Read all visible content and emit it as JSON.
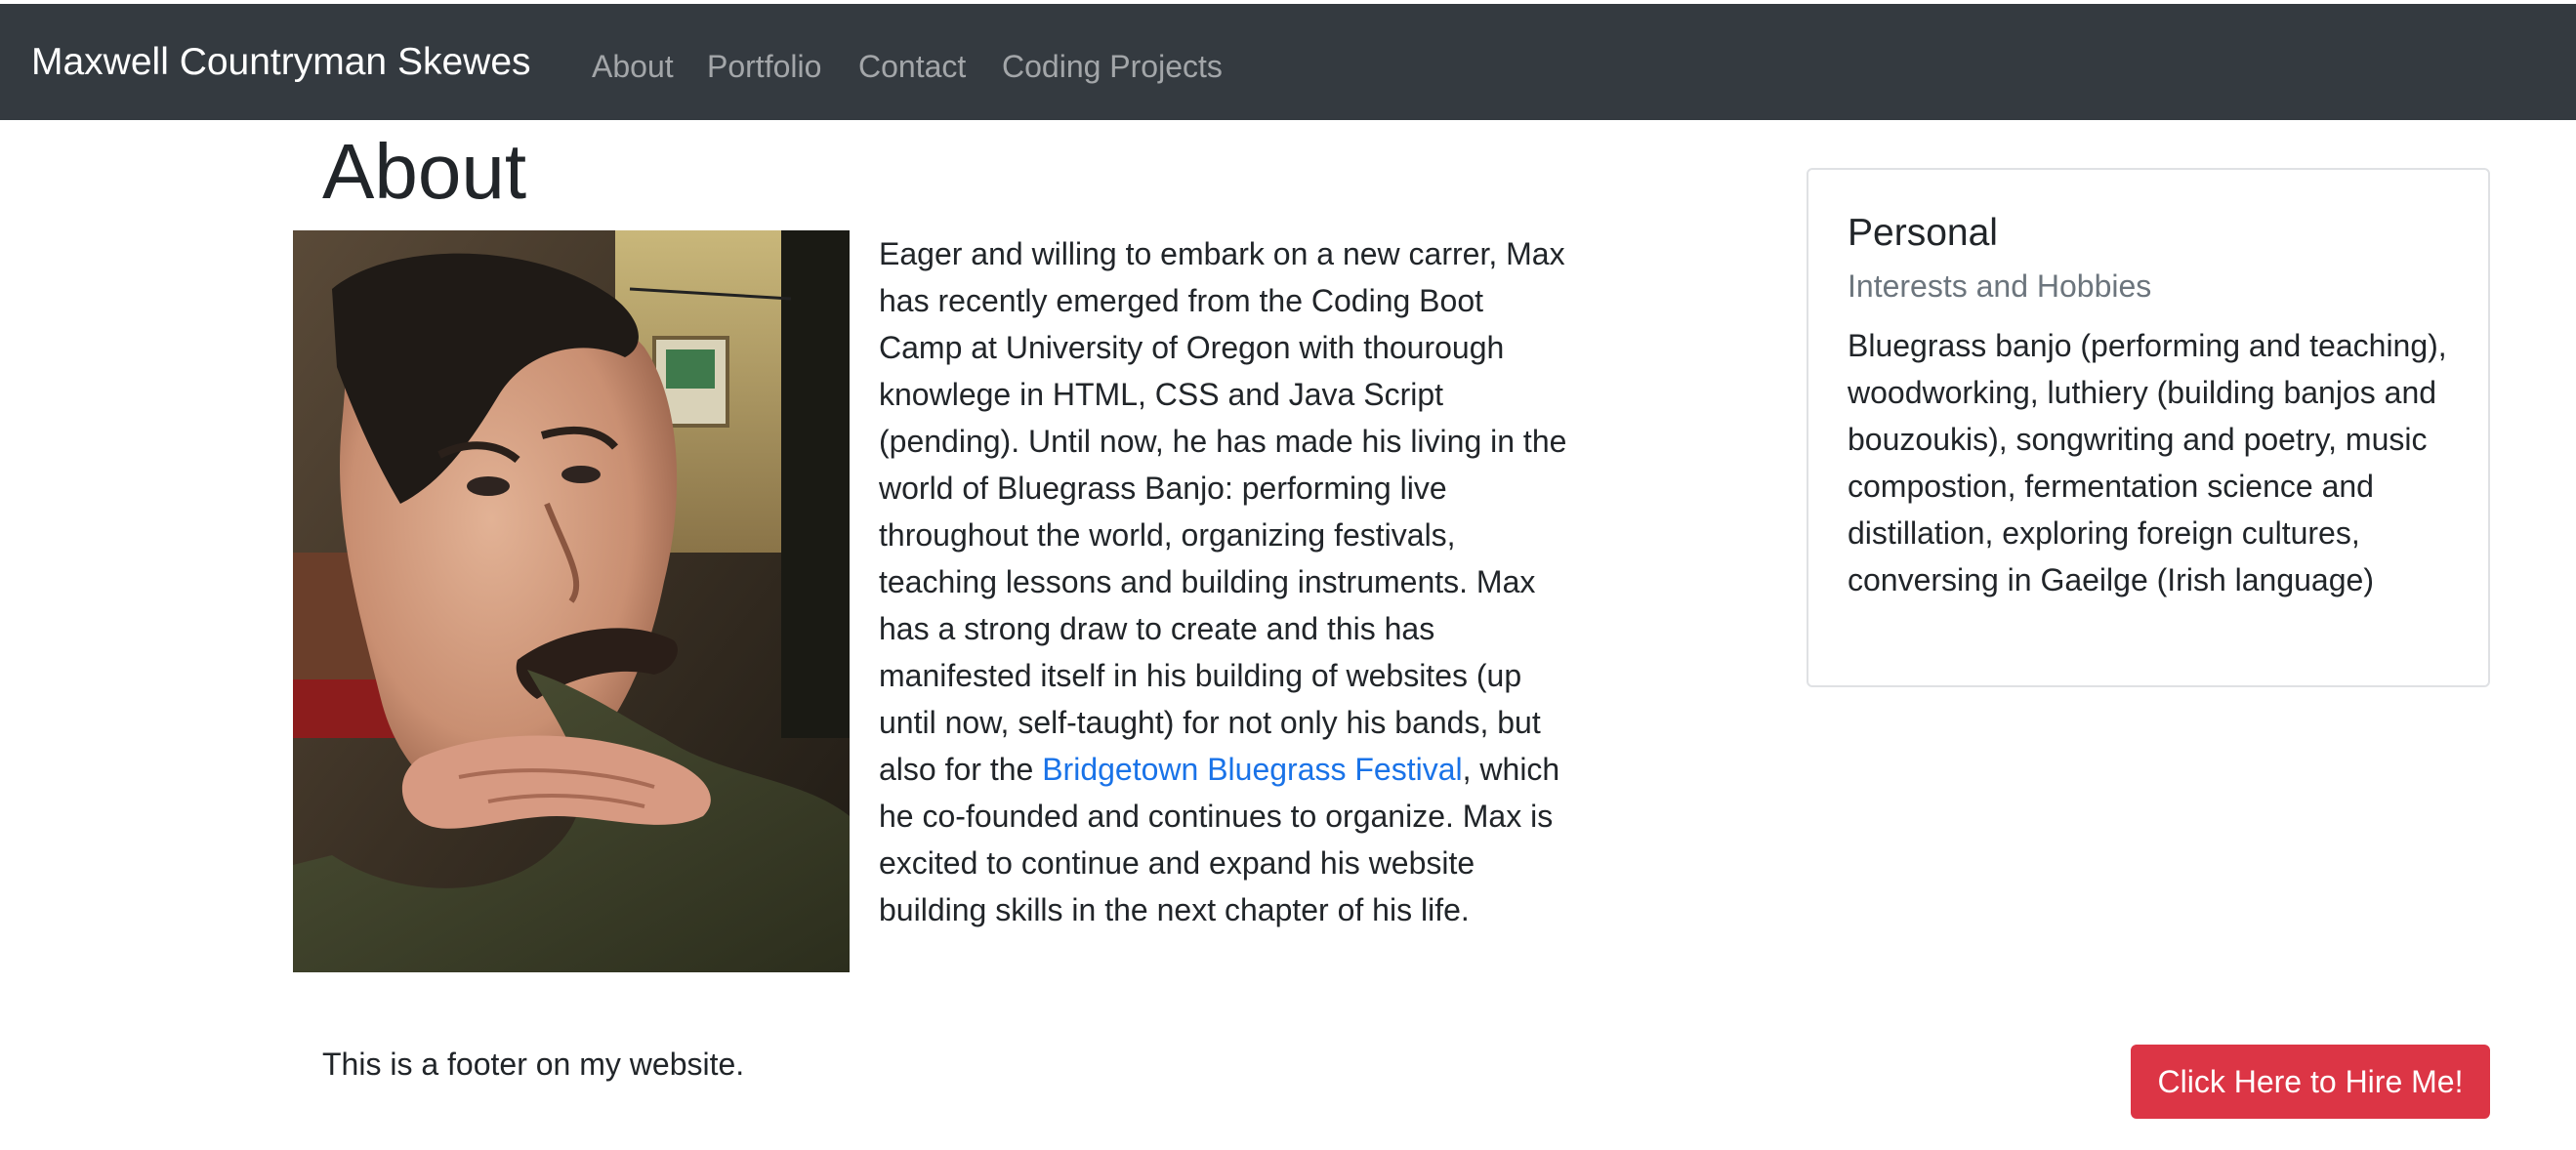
{
  "navbar": {
    "brand": "Maxwell Countryman Skewes",
    "links": [
      "About",
      "Portfolio",
      "Contact",
      "Coding Projects"
    ]
  },
  "main": {
    "title": "About",
    "bio": {
      "text_before_link": "Eager and willing to embark on a new carrer, Max has recently emerged from the Coding Boot Camp at University of Oregon with thourough knowlege in HTML, CSS and Java Script (pending). Until now, he has made his living in the world of Bluegrass Banjo: performing live throughout the world, organizing festivals, teaching lessons and building instruments. Max has a strong draw to create and this has manifested itself in his building of websites (up until now, self-taught) for not only his bands, but also for the ",
      "link_text": "Bridgetown Bluegrass Festival",
      "text_after_link": ", which he co-founded and continues to organize. Max is excited to continue and expand his website building skills in the next chapter of his life."
    }
  },
  "sidebar": {
    "card_title": "Personal",
    "card_subtitle": "Interests and Hobbies",
    "card_text": "Bluegrass banjo (performing and teaching), woodworking, luthiery (building banjos and bouzoukis), songwriting and poetry, music compostion, fermentation science and distillation, exploring foreign cultures, conversing in Gaeilge (Irish language)"
  },
  "footer": {
    "text": "This is a footer on my website.",
    "hire_button": "Click Here to Hire Me!"
  },
  "colors": {
    "navbar_bg": "#343a40",
    "link": "#1a73e8",
    "button_bg": "#dc3545",
    "muted_text": "#6c757d"
  }
}
